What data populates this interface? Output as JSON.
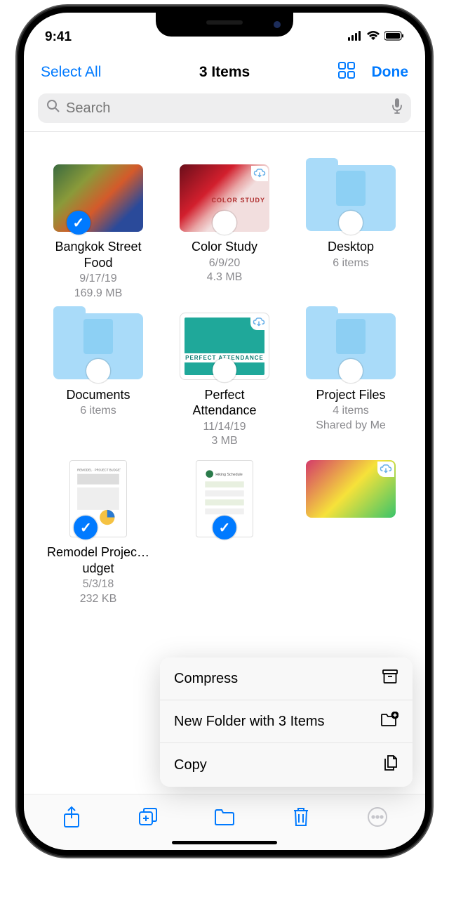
{
  "status": {
    "time": "9:41"
  },
  "nav": {
    "select_all": "Select All",
    "title": "3 Items",
    "done": "Done"
  },
  "search": {
    "placeholder": "Search"
  },
  "items": [
    {
      "name": "Bangkok Street Food",
      "date": "9/17/19",
      "size": "169.9 MB"
    },
    {
      "name": "Color Study",
      "date": "6/9/20",
      "size": "4.3 MB"
    },
    {
      "name": "Desktop",
      "date": "6 items",
      "size": ""
    },
    {
      "name": "Documents",
      "date": "6 items",
      "size": ""
    },
    {
      "name": "Perfect Attendance",
      "date": "11/14/19",
      "size": "3 MB"
    },
    {
      "name": "Project Files",
      "date": "4 items",
      "size": "Shared by Me"
    },
    {
      "name": "Remodel Projec…udget",
      "date": "5/3/18",
      "size": "232 KB"
    }
  ],
  "menu": {
    "compress": "Compress",
    "new_folder": "New Folder with 3 Items",
    "copy": "Copy"
  }
}
